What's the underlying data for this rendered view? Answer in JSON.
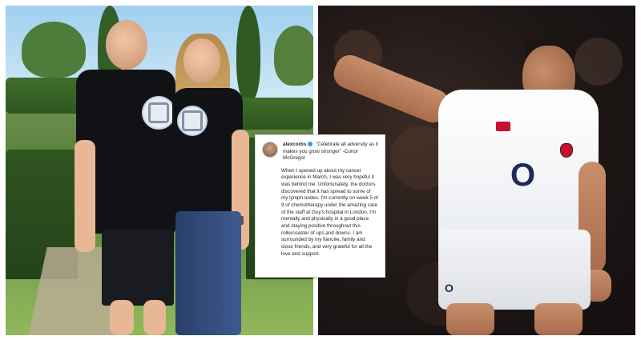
{
  "instagram_post": {
    "username": "alexcorbs",
    "quote": "\"Celebrate all adversity as it makes you grow stronger\" -Conor McGregor",
    "body": "When I opened up about my cancer experience in March, I was very hopeful it was behind me. Unfortunately, the doctors discovered that it has spread to some of my lymph nodes. I'm currently on week 5 of 9 of chemotherapy under the amazing care of the staff at Guy's hospital in London. I'm mentally and physically in a good place and staying positive throughout this rollercoaster of ups and downs. I am surrounded by my fiancée, family and close friends, and very grateful for all the love and support."
  },
  "left_photo": {
    "description_icon": "couple-in-garden"
  },
  "right_photo": {
    "jersey_logo": "O",
    "shorts_logo": "O"
  },
  "colors": {
    "england_red": "#c8102e",
    "jersey_navy": "#1d2a5a",
    "verified_blue": "#3897f0"
  }
}
